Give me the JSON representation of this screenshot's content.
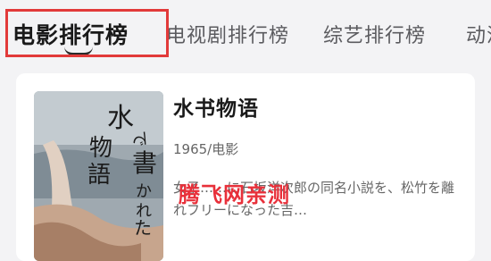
{
  "tabs": [
    {
      "label": "电影排行榜",
      "active": true
    },
    {
      "label": "电视剧排行榜",
      "active": false
    },
    {
      "label": "综艺排行榜",
      "active": false
    },
    {
      "label": "动漫",
      "active": false
    }
  ],
  "card": {
    "title": "水书物语",
    "meta": "1965/电影",
    "description": "女子……に石坂洋次郎の同名小説を、松竹を離れフリーになった吉…",
    "poster": {
      "title_art": "水で書かれた物語"
    }
  },
  "watermark": "腾飞网亲测",
  "colors": {
    "highlight": "#e23a3a",
    "watermark": "#e8303a"
  }
}
